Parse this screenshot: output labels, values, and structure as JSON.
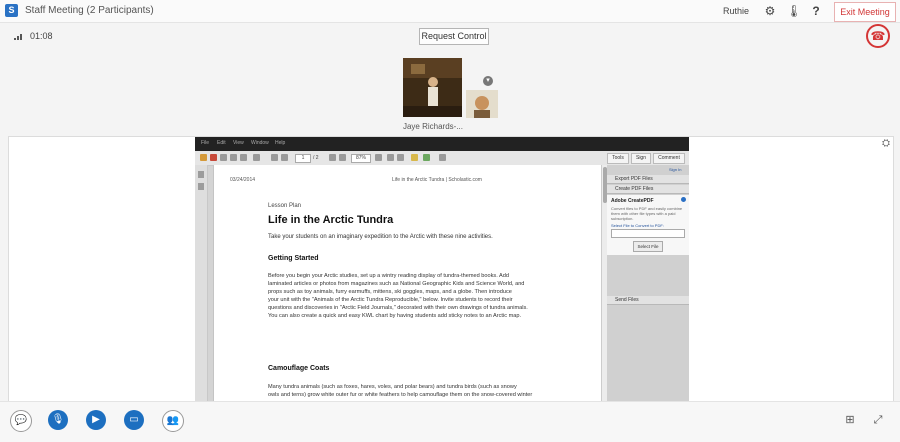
{
  "window": {
    "title": "Staff Meeting (2 Participants)",
    "user": "Ruthie",
    "exit_label": "Exit Meeting",
    "icons": [
      "gear-icon",
      "thermometer-icon",
      "help-icon"
    ]
  },
  "call": {
    "duration": "01:08",
    "request_control_label": "Request Control",
    "participant_name": "Jaye Richards-..."
  },
  "shared_app": {
    "menu": [
      "File",
      "Edit",
      "View",
      "Window",
      "Help"
    ],
    "page_current": "1",
    "page_total": "/ 2",
    "zoom": "87%",
    "right_tabs": [
      "Tools",
      "Sign",
      "Comment"
    ],
    "sign_in": "Sign In",
    "panel": {
      "export_pdf": "Export PDF Files",
      "create_pdf": "Create PDF Files",
      "adobe_title": "Adobe CreatePDF",
      "adobe_desc": "Convert files to PDF and easily combine them with other file types with a paid subscription.",
      "select_file_label": "Select File to Convert to PDF:",
      "select_button": "Select File",
      "send_files": "Send Files"
    }
  },
  "document": {
    "header_left": "03/24/2014",
    "header_mid": "Life in the Arctic Tundra | Scholastic.com",
    "label": "Lesson Plan",
    "title": "Life in the Arctic Tundra",
    "intro": "Take your students on an imaginary expedition to the Arctic with these nine activities.",
    "section1": "Getting Started",
    "para1": [
      "Before you begin your Arctic studies, set up a wintry reading display of tundra-themed books. Add",
      "laminated articles or photos from magazines such as National Geographic Kids and Science World, and",
      "props such as toy animals, furry earmuffs, mittens, ski goggles, maps, and a globe. Then introduce",
      "your unit with the \"Animals of the Arctic Tundra Reproducible,\" below. Invite students to record their",
      "questions and discoveries in \"Arctic Field Journals,\" decorated with their own drawings of tundra animals.",
      "You can also create a quick and easy KWL chart by having students add sticky notes to an Arctic map."
    ],
    "section2": "Camouflage Coats",
    "para2": [
      "Many tundra animals (such as foxes, hares, voles, and polar bears) and tundra birds (such as snowy",
      "owls and terns) grow white outer fur or white feathers to help camouflage them on the snow-covered winter"
    ]
  },
  "controls": {
    "buttons": [
      "chat-icon",
      "microphone-icon",
      "video-icon",
      "present-icon",
      "participants-icon"
    ],
    "right_icons": [
      "layout-icon",
      "fullscreen-icon"
    ]
  }
}
